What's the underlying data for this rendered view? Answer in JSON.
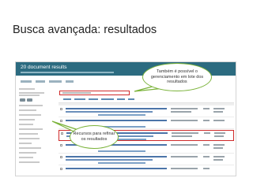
{
  "slide": {
    "title": "Busca avançada: resultados"
  },
  "app": {
    "results_title": "20 document results"
  },
  "callouts": {
    "batch_management": "Também é possível o gerenciamento em lote dos resultados",
    "refine": "Recursos para refinar os resultados"
  },
  "colors": {
    "header": "#2c6b80",
    "highlight_border": "#cf2a2a",
    "callout_border": "#7bb33a"
  }
}
